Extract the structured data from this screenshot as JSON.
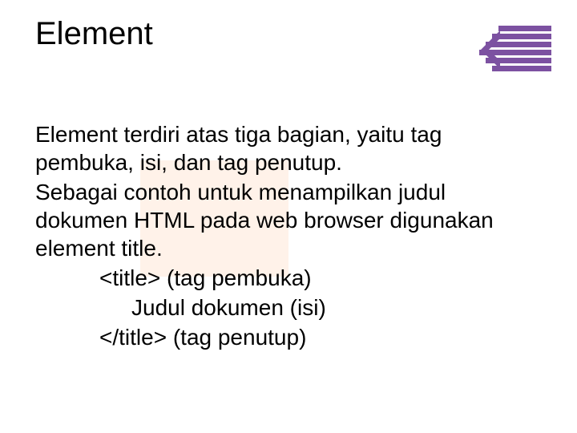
{
  "title": "Element",
  "body": {
    "p1_a": "Element terdiri atas tiga bagian, yaitu ",
    "p1_b": "tag pembuka, isi, dan tag penutup.",
    "p2_a": "Sebagai contoh untuk menampilkan judul dokumen HTML pada web browser digunakan ",
    "p2_b": "element title.",
    "ex1": "<title> (tag pembuka)",
    "ex2": "Judul dokumen (isi)",
    "ex3": "</title> (tag penutup)"
  },
  "logo": {
    "name": "stacked-bars-arrow-logo",
    "color": "#7c51a1"
  }
}
